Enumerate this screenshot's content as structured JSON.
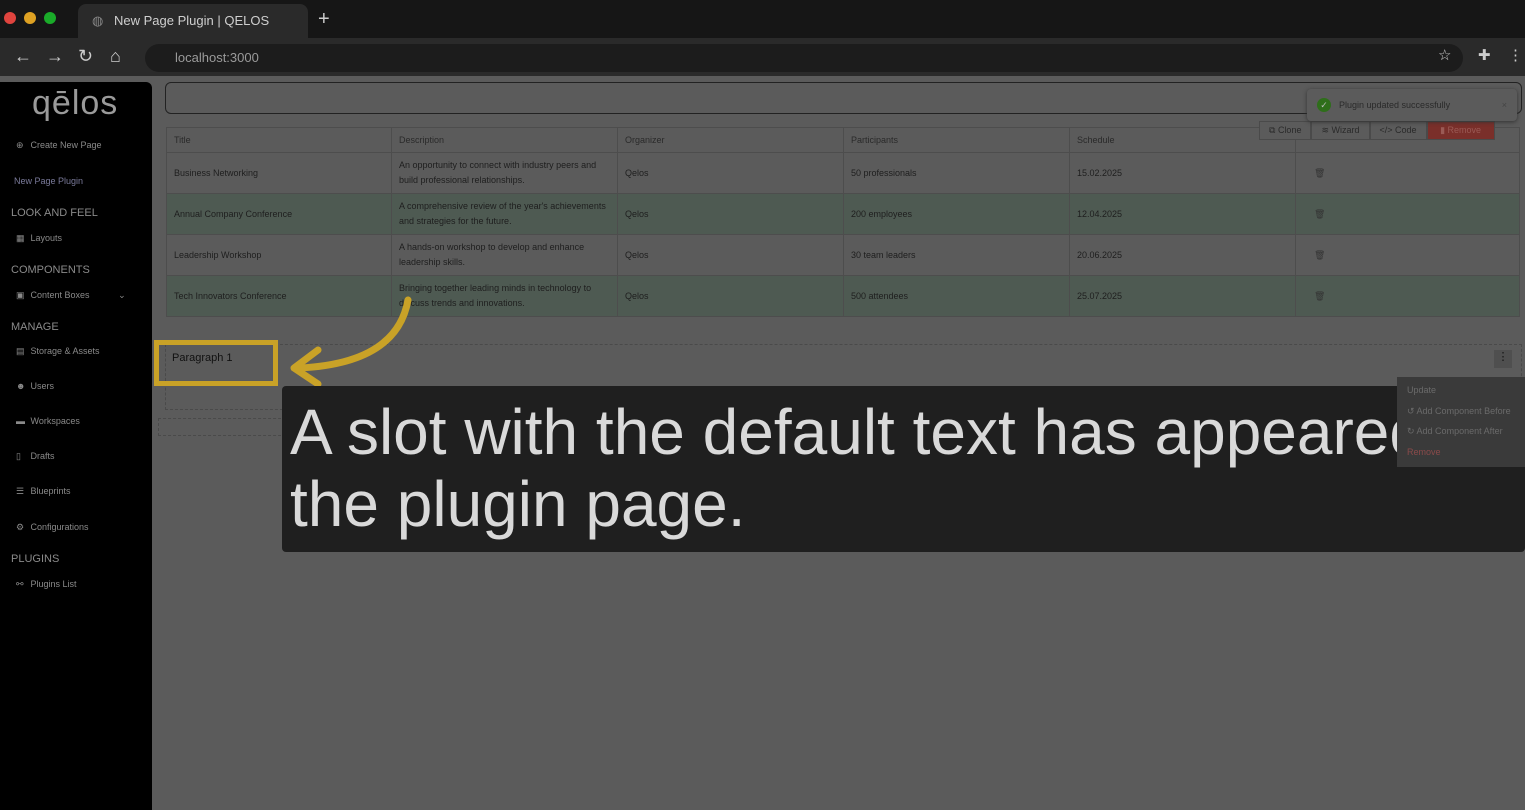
{
  "browser": {
    "tab_title": "New Page Plugin | QELOS",
    "url": "localhost:3000"
  },
  "sidebar": {
    "logo": "qēlos",
    "create": "Create New Page",
    "current": "New Page Plugin",
    "sections": {
      "look": "LOOK AND FEEL",
      "components": "COMPONENTS",
      "manage": "MANAGE",
      "plugins": "PLUGINS"
    },
    "items": {
      "layouts": "Layouts",
      "content_boxes": "Content Boxes",
      "storage": "Storage & Assets",
      "users": "Users",
      "workspaces": "Workspaces",
      "drafts": "Drafts",
      "blueprints": "Blueprints",
      "configurations": "Configurations",
      "plugins_list": "Plugins List"
    }
  },
  "toast": "Plugin updated successfully",
  "toolbar": {
    "clone": "Clone",
    "wizard": "Wizard",
    "code": "Code",
    "remove": "Remove"
  },
  "table": {
    "headers": [
      "Title",
      "Description",
      "Organizer",
      "Participants",
      "Schedule"
    ],
    "rows": [
      [
        "Business Networking",
        "An opportunity to connect with industry peers and build professional relationships.",
        "Qelos",
        "50 professionals",
        "15.02.2025"
      ],
      [
        "Annual Company Conference",
        "A comprehensive review of the year's achievements and strategies for the future.",
        "Qelos",
        "200 employees",
        "12.04.2025"
      ],
      [
        "Leadership Workshop",
        "A hands-on workshop to develop and enhance leadership skills.",
        "Qelos",
        "30 team leaders",
        "20.06.2025"
      ],
      [
        "Tech Innovators Conference",
        "Bringing together leading minds in technology to discuss trends and innovations.",
        "Qelos",
        "500 attendees",
        "25.07.2025"
      ]
    ]
  },
  "slot": {
    "text": "Paragraph 1"
  },
  "menu": {
    "update": "Update",
    "before": "Add Component Before",
    "after": "Add Component After",
    "remove": "Remove"
  },
  "caption": "A slot with the default text has appeared on the plugin page.",
  "colors": {
    "highlight": "#c9a227",
    "caption_bg": "#1f1f1f"
  }
}
